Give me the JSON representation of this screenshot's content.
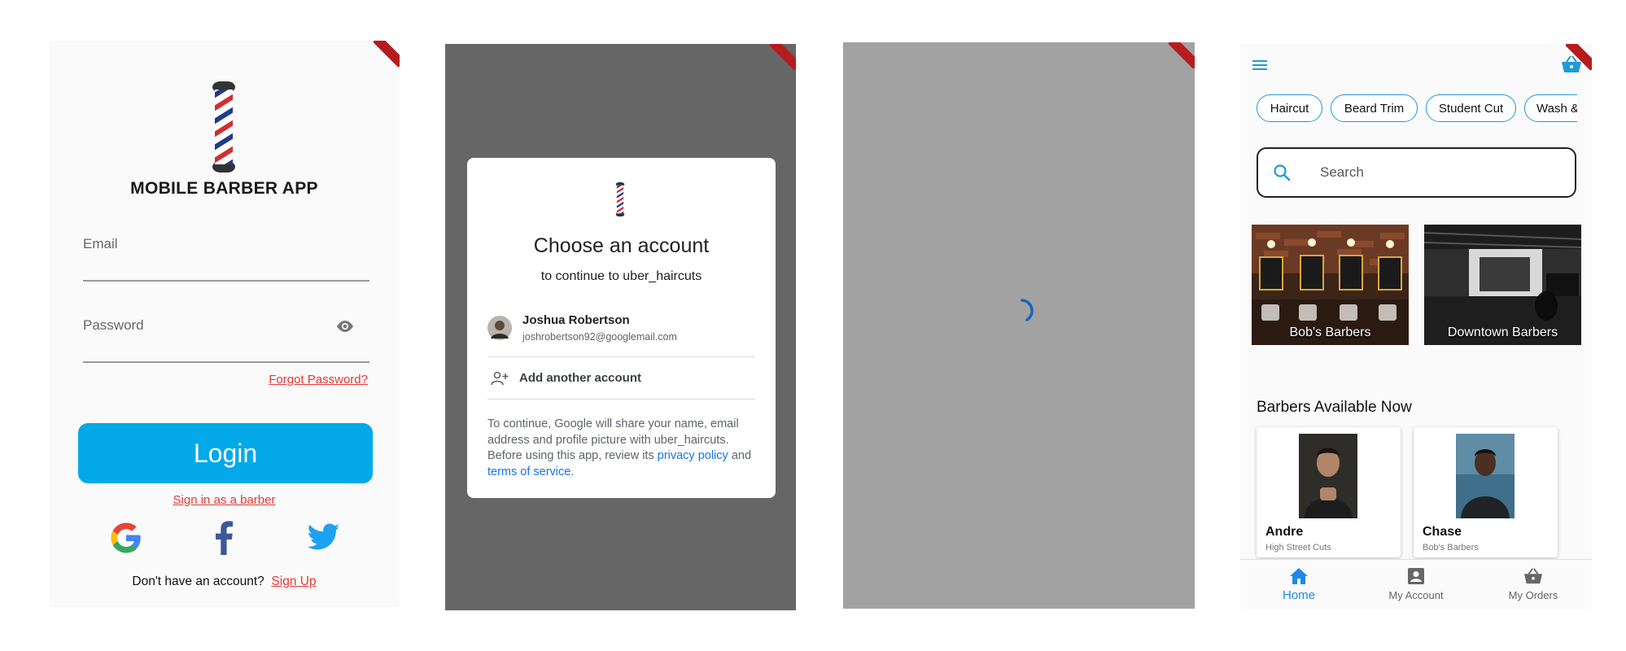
{
  "login": {
    "app_title": "MOBILE BARBER APP",
    "email_placeholder": "Email",
    "password_placeholder": "Password",
    "forgot_password": "Forgot Password?",
    "login_button": "Login",
    "barber_signin": "Sign in as a barber",
    "no_account_text": "Don't have an account?",
    "sign_up": "Sign Up",
    "social_icons": [
      "google-icon",
      "facebook-icon",
      "twitter-icon"
    ]
  },
  "account_chooser": {
    "title": "Choose an account",
    "subtitle": "to continue to uber_haircuts",
    "account_name": "Joshua Robertson",
    "account_email": "joshrobertson92@googlemail.com",
    "add_account": "Add another account",
    "disclaimer_pre": "To continue, Google will share your name, email address and profile picture with uber_haircuts. Before using this app, review its",
    "privacy_policy": "privacy policy",
    "and_text": "and",
    "terms": "terms of service",
    "period": "."
  },
  "home": {
    "chips": [
      "Haircut",
      "Beard Trim",
      "Student Cut",
      "Wash &"
    ],
    "search_placeholder": "Search",
    "shops": [
      "Bob's Barbers",
      "Downtown Barbers"
    ],
    "section_title": "Barbers Available Now",
    "barbers": [
      {
        "name": "Andre",
        "shop": "High Street Cuts"
      },
      {
        "name": "Chase",
        "shop": "Bob's Barbers"
      }
    ],
    "nav": [
      "Home",
      "My Account",
      "My Orders"
    ],
    "accent_color": "#1e9bd6"
  },
  "colors": {
    "login_button": "#03a9e9",
    "link_red": "#e53935",
    "google_link": "#1a73e8"
  }
}
